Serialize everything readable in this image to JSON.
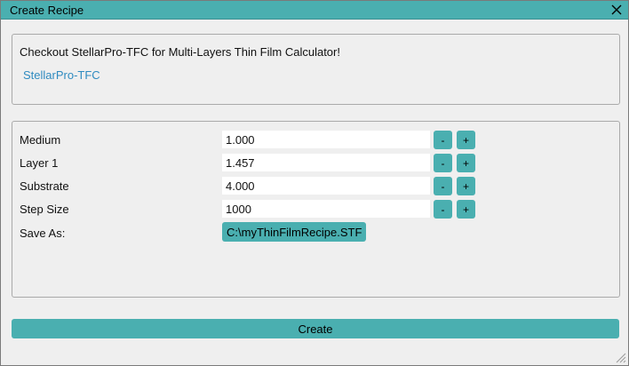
{
  "window": {
    "title": "Create Recipe"
  },
  "promo": {
    "text": "Checkout StellarPro-TFC for Multi-Layers Thin Film Calculator!",
    "link_label": "StellarPro-TFC"
  },
  "form": {
    "rows": [
      {
        "label": "Medium",
        "value": "1.000",
        "minus": "-",
        "plus": "+"
      },
      {
        "label": "Layer 1",
        "value": "1.457",
        "minus": "-",
        "plus": "+"
      },
      {
        "label": "Substrate",
        "value": "4.000",
        "minus": "-",
        "plus": "+"
      },
      {
        "label": "Step Size",
        "value": "1000",
        "minus": "-",
        "plus": "+"
      }
    ],
    "save_label": "Save As:",
    "save_path": "C:\\myThinFilmRecipe.STF"
  },
  "actions": {
    "create_label": "Create"
  },
  "colors": {
    "accent": "#4aafb0",
    "link": "#2f8bc0",
    "background": "#efefef"
  }
}
